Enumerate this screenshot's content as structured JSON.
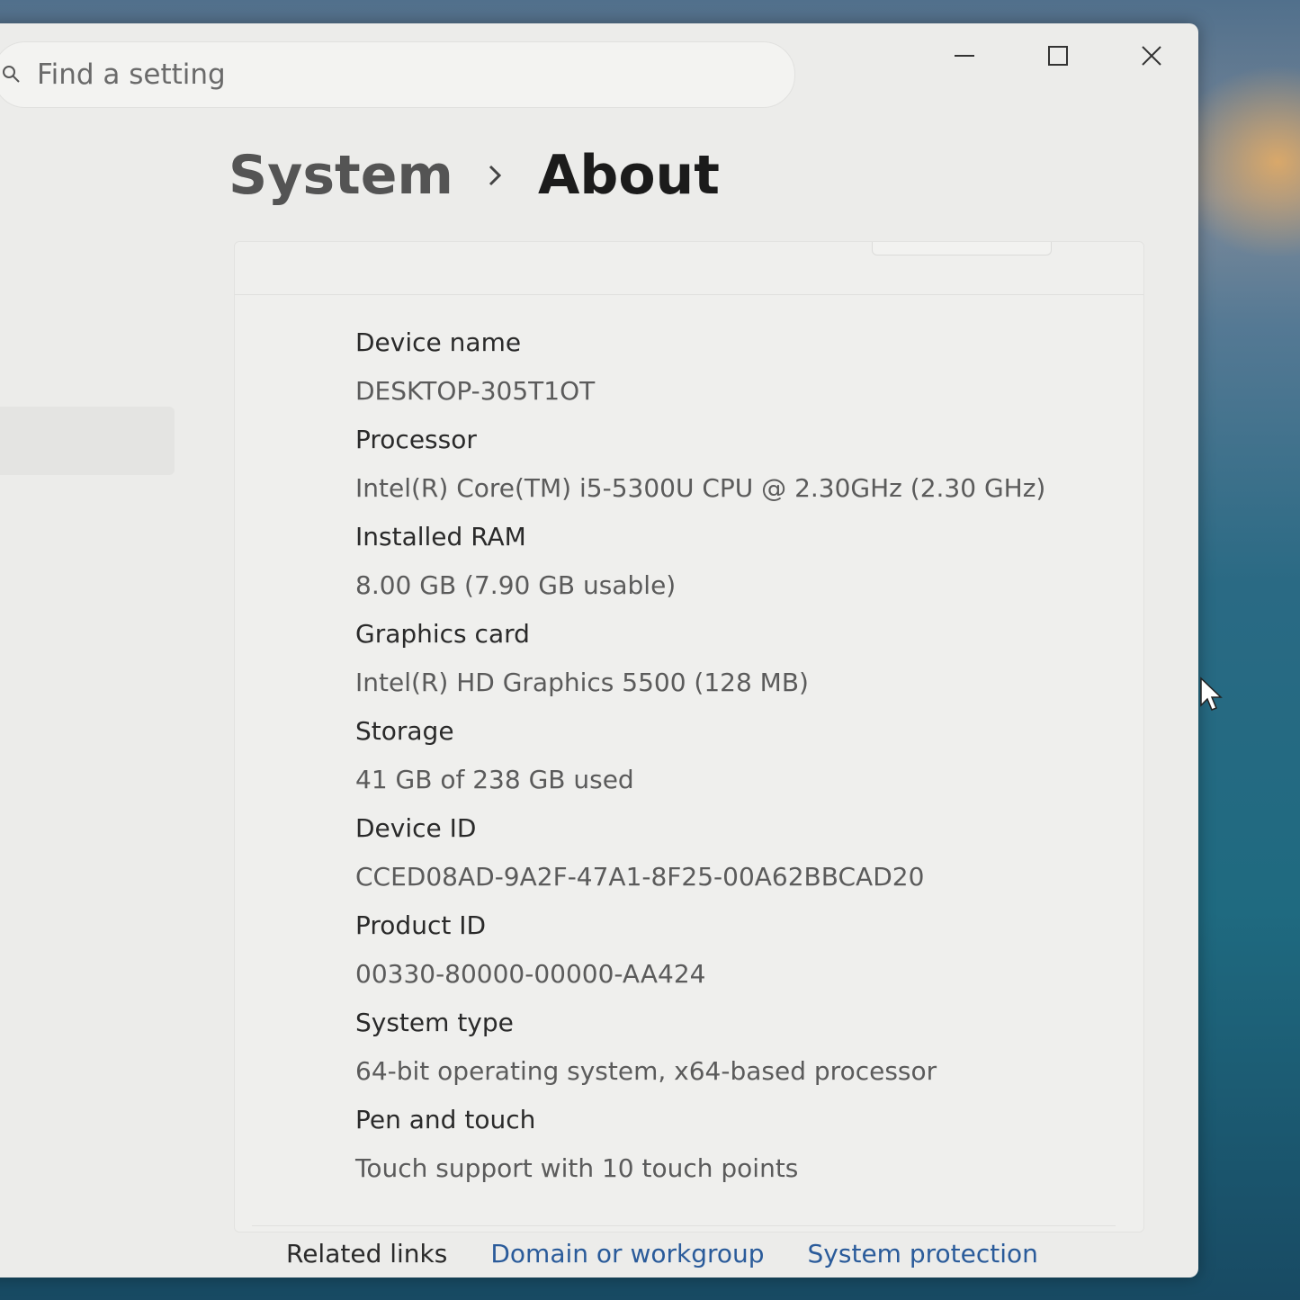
{
  "search": {
    "placeholder": "Find a setting"
  },
  "window_controls": {
    "minimize_icon": "minimize-icon",
    "maximize_icon": "maximize-icon",
    "close_icon": "close-icon"
  },
  "breadcrumb": {
    "parent": "System",
    "current": "About"
  },
  "specs": [
    {
      "label": "Device name",
      "value": "DESKTOP-305T1OT"
    },
    {
      "label": "Processor",
      "value": "Intel(R) Core(TM) i5-5300U CPU @ 2.30GHz (2.30 GHz)"
    },
    {
      "label": "Installed RAM",
      "value": "8.00 GB (7.90 GB usable)"
    },
    {
      "label": "Graphics card",
      "value": "Intel(R) HD Graphics 5500 (128 MB)"
    },
    {
      "label": "Storage",
      "value": "41 GB of 238 GB used"
    },
    {
      "label": "Device ID",
      "value": "CCED08AD-9A2F-47A1-8F25-00A62BBCAD20"
    },
    {
      "label": "Product ID",
      "value": "00330-80000-00000-AA424"
    },
    {
      "label": "System type",
      "value": "64-bit operating system, x64-based processor"
    },
    {
      "label": "Pen and touch",
      "value": "Touch support with 10 touch points"
    }
  ],
  "related": {
    "label": "Related links",
    "links": [
      "Domain or workgroup",
      "System protection"
    ]
  },
  "colors": {
    "link": "#2a5b9a",
    "window_bg": "#ececea"
  }
}
